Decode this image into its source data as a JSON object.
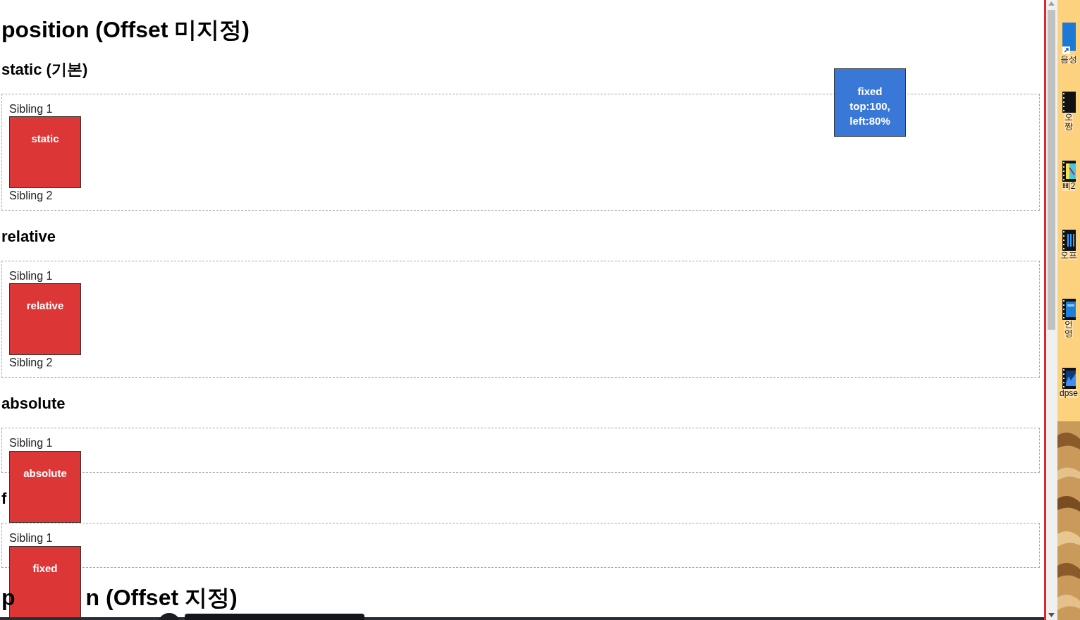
{
  "page": {
    "title": "position (Offset 미지정)",
    "sections": [
      {
        "heading": "static (기본)",
        "kind": "flow",
        "siblings": [
          "Sibling 1",
          "Sibling 2"
        ],
        "box_label": "static"
      },
      {
        "heading": "relative",
        "kind": "flow",
        "siblings": [
          "Sibling 1",
          "Sibling 2"
        ],
        "box_label": "relative"
      },
      {
        "heading": "absolute",
        "kind": "overlay",
        "siblings": [
          "Sibling 1"
        ],
        "box_label": "absolute"
      },
      {
        "heading": "f",
        "kind": "overlay",
        "siblings": [
          "Sibling 1"
        ],
        "box_label": "fixed"
      }
    ],
    "second_title_parts": [
      "p",
      "n (Offset 지정)"
    ],
    "fixed_box": "fixed top:100, left:80%"
  },
  "desktop": {
    "icons": [
      {
        "kind": "shortcut",
        "labels": [
          "음성"
        ]
      },
      {
        "kind": "video",
        "labels": [
          "오",
          "짱"
        ]
      },
      {
        "kind": "video-color",
        "labels": [
          "삐2"
        ]
      },
      {
        "kind": "video-bars",
        "labels": [
          "오프"
        ]
      },
      {
        "kind": "video-blue",
        "labels": [
          "언",
          "영"
        ]
      },
      {
        "kind": "video-wave",
        "labels": [
          "dpse"
        ]
      }
    ]
  }
}
